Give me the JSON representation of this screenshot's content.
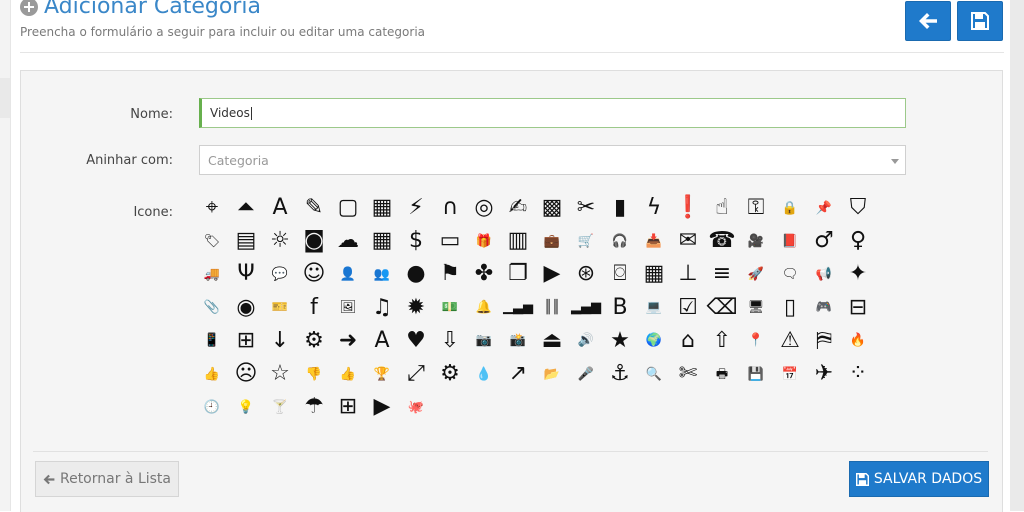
{
  "header": {
    "title": "Adicionar Categoria",
    "subtitle": "Preencha o formulário a seguir para incluir ou editar uma categoria",
    "back_icon": "arrow-left-icon",
    "save_icon": "floppy-disk-icon"
  },
  "form": {
    "name_label": "Nome:",
    "name_value": "Videos",
    "nest_label": "Aninhar com:",
    "nest_value": "Categoria",
    "icon_label": "Icone:"
  },
  "icons": [
    {
      "name": "crosshairs-icon",
      "glyph": "⌖"
    },
    {
      "name": "compass-icon",
      "glyph": "⏶"
    },
    {
      "name": "font-icon",
      "glyph": "A"
    },
    {
      "name": "pencil-icon",
      "glyph": "✎"
    },
    {
      "name": "square-icon",
      "glyph": "▢"
    },
    {
      "name": "table-icon",
      "glyph": "▦"
    },
    {
      "name": "magic-icon",
      "glyph": "⚡"
    },
    {
      "name": "magnet-icon",
      "glyph": "∩"
    },
    {
      "name": "bullseye-icon",
      "glyph": "◎"
    },
    {
      "name": "edit-icon",
      "glyph": "✍"
    },
    {
      "name": "qrcode-icon",
      "glyph": "▩"
    },
    {
      "name": "wrench-icon",
      "glyph": "✂"
    },
    {
      "name": "bookmark-icon",
      "glyph": "▮"
    },
    {
      "name": "bolt-icon",
      "glyph": "ϟ"
    },
    {
      "name": "exclamation-icon",
      "glyph": "❗"
    },
    {
      "name": "hand-pointer-icon",
      "glyph": "☝"
    },
    {
      "name": "key-icon",
      "glyph": "⚿"
    },
    {
      "name": "lock-icon",
      "glyph": "🔒"
    },
    {
      "name": "pushpin-icon",
      "glyph": "📌"
    },
    {
      "name": "shield-icon",
      "glyph": "⛉"
    },
    {
      "name": "tag-icon",
      "glyph": "🏷"
    },
    {
      "name": "archive-icon",
      "glyph": "▤"
    },
    {
      "name": "sun-icon",
      "glyph": "☼"
    },
    {
      "name": "rss-icon",
      "glyph": "◙"
    },
    {
      "name": "cloud-icon",
      "glyph": "☁"
    },
    {
      "name": "th-icon",
      "glyph": "▦"
    },
    {
      "name": "dollar-icon",
      "glyph": "$"
    },
    {
      "name": "credit-card-icon",
      "glyph": "▭"
    },
    {
      "name": "gift-icon",
      "glyph": "🎁"
    },
    {
      "name": "building-icon",
      "glyph": "▥"
    },
    {
      "name": "briefcase-icon",
      "glyph": "💼"
    },
    {
      "name": "shopping-cart-icon",
      "glyph": "🛒"
    },
    {
      "name": "headphones-icon",
      "glyph": "🎧"
    },
    {
      "name": "inbox-icon",
      "glyph": "📥"
    },
    {
      "name": "envelope-icon",
      "glyph": "✉"
    },
    {
      "name": "phone-icon",
      "glyph": "☎"
    },
    {
      "name": "video-camera-icon",
      "glyph": "🎥"
    },
    {
      "name": "book-icon",
      "glyph": "📕"
    },
    {
      "name": "male-icon",
      "glyph": "♂"
    },
    {
      "name": "female-icon",
      "glyph": "♀"
    },
    {
      "name": "truck-icon",
      "glyph": "🚚"
    },
    {
      "name": "code-fork-icon",
      "glyph": "Ψ"
    },
    {
      "name": "comment-icon",
      "glyph": "💬"
    },
    {
      "name": "smile-icon",
      "glyph": "☺"
    },
    {
      "name": "user-icon",
      "glyph": "👤"
    },
    {
      "name": "users-icon",
      "glyph": "👥"
    },
    {
      "name": "circle-icon",
      "glyph": "●"
    },
    {
      "name": "flag-icon",
      "glyph": "⚑"
    },
    {
      "name": "puzzle-piece-icon",
      "glyph": "✤"
    },
    {
      "name": "copy-icon",
      "glyph": "❐"
    },
    {
      "name": "play-circle-icon",
      "glyph": "▶"
    },
    {
      "name": "dribbble-icon",
      "glyph": "⊛"
    },
    {
      "name": "hdd-icon",
      "glyph": "⌼"
    },
    {
      "name": "dashboard-grid-icon",
      "glyph": "▦"
    },
    {
      "name": "sitemap-icon",
      "glyph": "⊥"
    },
    {
      "name": "server-icon",
      "glyph": "≡"
    },
    {
      "name": "rocket-icon",
      "glyph": "🚀"
    },
    {
      "name": "comment-outline-icon",
      "glyph": "🗨"
    },
    {
      "name": "bullhorn-icon",
      "glyph": "📢"
    },
    {
      "name": "dropbox-icon",
      "glyph": "✦"
    },
    {
      "name": "paperclip-icon",
      "glyph": "📎"
    },
    {
      "name": "weibo-icon",
      "glyph": "◉"
    },
    {
      "name": "ticket-icon",
      "glyph": "🎫"
    },
    {
      "name": "facebook-icon",
      "glyph": "f"
    },
    {
      "name": "picture-icon",
      "glyph": "🖼"
    },
    {
      "name": "music-icon",
      "glyph": "♫"
    },
    {
      "name": "certificate-icon",
      "glyph": "✹"
    },
    {
      "name": "money-icon",
      "glyph": "💵"
    },
    {
      "name": "bell-icon",
      "glyph": "🔔"
    },
    {
      "name": "signal-icon",
      "glyph": "▁▃▅"
    },
    {
      "name": "barcode-icon",
      "glyph": "║║"
    },
    {
      "name": "bar-chart-icon",
      "glyph": "▂▄▆"
    },
    {
      "name": "bold-icon",
      "glyph": "B"
    },
    {
      "name": "laptop-icon",
      "glyph": "💻"
    },
    {
      "name": "check-square-icon",
      "glyph": "☑"
    },
    {
      "name": "eraser-icon",
      "glyph": "⌫"
    },
    {
      "name": "desktop-icon",
      "glyph": "🖥"
    },
    {
      "name": "tablet-icon",
      "glyph": "▯"
    },
    {
      "name": "gamepad-icon",
      "glyph": "🎮"
    },
    {
      "name": "hdd-drive-icon",
      "glyph": "⊟"
    },
    {
      "name": "mobile-icon",
      "glyph": "📱"
    },
    {
      "name": "plus-square-icon",
      "glyph": "⊞"
    },
    {
      "name": "sort-alpha-icon",
      "glyph": "↓"
    },
    {
      "name": "cogs-icon",
      "glyph": "⚙"
    },
    {
      "name": "arrow-right-icon",
      "glyph": "➜"
    },
    {
      "name": "font-serif-icon",
      "glyph": "A"
    },
    {
      "name": "heart-icon",
      "glyph": "♥"
    },
    {
      "name": "cloud-download-icon",
      "glyph": "⇩"
    },
    {
      "name": "photo-camera-icon",
      "glyph": "📷"
    },
    {
      "name": "camera-icon",
      "glyph": "📸"
    },
    {
      "name": "caret-square-up-icon",
      "glyph": "⏏"
    },
    {
      "name": "volume-up-icon",
      "glyph": "🔊"
    },
    {
      "name": "star-icon",
      "glyph": "★"
    },
    {
      "name": "globe-icon",
      "glyph": "🌍"
    },
    {
      "name": "home-icon",
      "glyph": "⌂"
    },
    {
      "name": "arrow-circle-up-icon",
      "glyph": "⇧"
    },
    {
      "name": "map-marker-icon",
      "glyph": "📍"
    },
    {
      "name": "warning-icon",
      "glyph": "⚠"
    },
    {
      "name": "bookmark-outline-icon",
      "glyph": "⛿"
    },
    {
      "name": "fire-icon",
      "glyph": "🔥"
    },
    {
      "name": "thumbs-up-outline-icon",
      "glyph": "👍"
    },
    {
      "name": "frown-icon",
      "glyph": "☹"
    },
    {
      "name": "star-outline-icon",
      "glyph": "☆"
    },
    {
      "name": "thumbs-down-icon",
      "glyph": "👎"
    },
    {
      "name": "thumbs-up-icon",
      "glyph": "👍"
    },
    {
      "name": "trophy-icon",
      "glyph": "🏆"
    },
    {
      "name": "expand-icon",
      "glyph": "⤢"
    },
    {
      "name": "cog-icon",
      "glyph": "⚙"
    },
    {
      "name": "tint-icon",
      "glyph": "💧"
    },
    {
      "name": "share-icon",
      "glyph": "↗"
    },
    {
      "name": "folder-open-icon",
      "glyph": "📂"
    },
    {
      "name": "microphone-icon",
      "glyph": "🎤"
    },
    {
      "name": "anchor-icon",
      "glyph": "⚓"
    },
    {
      "name": "search-icon",
      "glyph": "🔍"
    },
    {
      "name": "scissors-icon",
      "glyph": "✄"
    },
    {
      "name": "print-icon",
      "glyph": "🖶"
    },
    {
      "name": "save-icon",
      "glyph": "💾"
    },
    {
      "name": "calendar-icon",
      "glyph": "📅"
    },
    {
      "name": "plane-icon",
      "glyph": "✈"
    },
    {
      "name": "spinner-icon",
      "glyph": "⁘"
    },
    {
      "name": "clock-icon",
      "glyph": "🕘"
    },
    {
      "name": "lightbulb-icon",
      "glyph": "💡"
    },
    {
      "name": "glass-icon",
      "glyph": "🍸"
    },
    {
      "name": "umbrella-icon",
      "glyph": "☂"
    },
    {
      "name": "windows-icon",
      "glyph": "⊞"
    },
    {
      "name": "youtube-icon",
      "glyph": "▶"
    },
    {
      "name": "github-icon",
      "glyph": "🐙"
    }
  ],
  "footer": {
    "return_label": "Retornar à Lista",
    "save_label": "SALVAR DADOS"
  }
}
